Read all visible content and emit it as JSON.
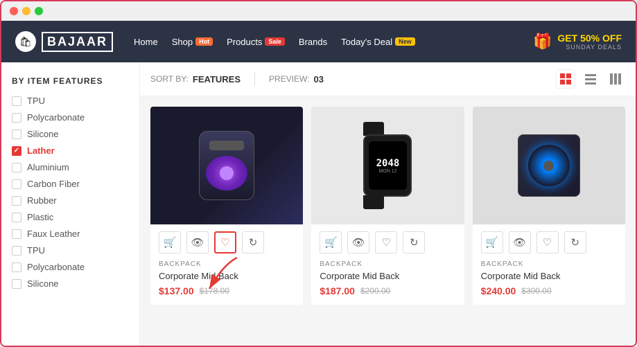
{
  "browser": {
    "dots": [
      "red",
      "yellow",
      "green"
    ]
  },
  "navbar": {
    "logo_text": "BAJAAR",
    "links": [
      {
        "label": "Home",
        "badge": null
      },
      {
        "label": "Shop",
        "badge": "Hot",
        "badge_type": "hot"
      },
      {
        "label": "Products",
        "badge": "Sale",
        "badge_type": "sale"
      },
      {
        "label": "Brands",
        "badge": null
      },
      {
        "label": "Today's Deal",
        "badge": "New",
        "badge_type": "new"
      }
    ],
    "promo_title": "GET 50% OFF",
    "promo_sub": "SUNDAY DEALS"
  },
  "sort_bar": {
    "sort_label": "SORT BY:",
    "sort_value": "FEATURES",
    "preview_label": "PREVIEW:",
    "preview_value": "03"
  },
  "sidebar": {
    "title": "BY ITEM FEATURES",
    "filters": [
      {
        "label": "TPU",
        "checked": false,
        "active": false
      },
      {
        "label": "Polycarbonate",
        "checked": false,
        "active": false
      },
      {
        "label": "Silicone",
        "checked": false,
        "active": false
      },
      {
        "label": "Lather",
        "checked": true,
        "active": true
      },
      {
        "label": "Aluminium",
        "checked": false,
        "active": false
      },
      {
        "label": "Carbon Fiber",
        "checked": false,
        "active": false
      },
      {
        "label": "Rubber",
        "checked": false,
        "active": false
      },
      {
        "label": "Plastic",
        "checked": false,
        "active": false
      },
      {
        "label": "Faux Leather",
        "checked": false,
        "active": false
      },
      {
        "label": "TPU",
        "checked": false,
        "active": false
      },
      {
        "label": "Polycarbonate",
        "checked": false,
        "active": false
      },
      {
        "label": "Silicone",
        "checked": false,
        "active": false
      }
    ]
  },
  "products": [
    {
      "category": "BACKPACK",
      "name": "Corporate Mid Back",
      "price_current": "$137.00",
      "price_original": "$178.00",
      "img_type": "speaker"
    },
    {
      "category": "BACKPACK",
      "name": "Corporate Mid Back",
      "price_current": "$187.00",
      "price_original": "$200.00",
      "img_type": "watch"
    },
    {
      "category": "BACKPACK",
      "name": "Corporate Mid Back",
      "price_current": "$240.00",
      "price_original": "$300.00",
      "img_type": "pc"
    }
  ],
  "actions": {
    "cart_icon": "🛒",
    "eye_icon": "👁",
    "heart_icon": "♡",
    "refresh_icon": "↻"
  },
  "view_icons": {
    "grid_active": true
  }
}
